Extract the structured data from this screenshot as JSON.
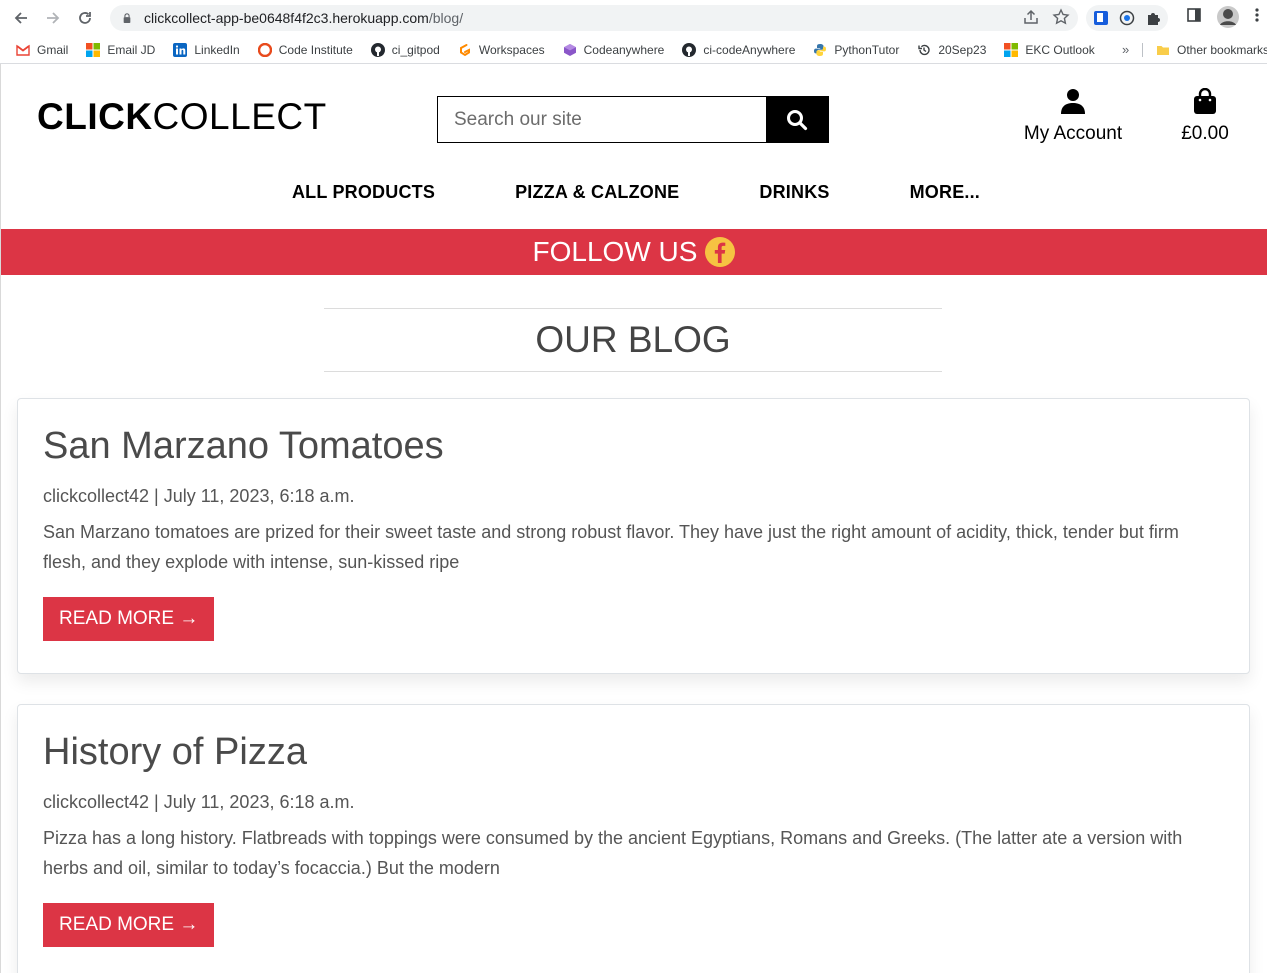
{
  "browser": {
    "url_host": "clickcollect-app-be0648f4f2c3.herokuapp.com",
    "url_path": "/blog/",
    "bookmarks": [
      {
        "label": "Gmail",
        "icon": "gmail-icon"
      },
      {
        "label": "Email JD",
        "icon": "microsoft-icon"
      },
      {
        "label": "LinkedIn",
        "icon": "linkedin-icon"
      },
      {
        "label": "Code Institute",
        "icon": "code-institute-icon"
      },
      {
        "label": "ci_gitpod",
        "icon": "github-icon"
      },
      {
        "label": "Workspaces",
        "icon": "gitpod-icon"
      },
      {
        "label": "Codeanywhere",
        "icon": "codeanywhere-icon"
      },
      {
        "label": "ci-codeAnywhere",
        "icon": "github-icon"
      },
      {
        "label": "PythonTutor",
        "icon": "python-icon"
      },
      {
        "label": "20Sep23",
        "icon": "history-icon"
      },
      {
        "label": "EKC Outlook",
        "icon": "microsoft-icon"
      }
    ],
    "more_bookmarks": "»",
    "other_bookmarks": "Other bookmarks"
  },
  "site": {
    "logo_bold": "CLICK",
    "logo_rest": "COLLECT",
    "search_placeholder": "Search our site",
    "account_label": "My Account",
    "cart_total": "£0.00",
    "nav": [
      "ALL PRODUCTS",
      "PIZZA & CALZONE",
      "DRINKS",
      "MORE..."
    ],
    "follow_text": "FOLLOW US",
    "brand_color": "#dc3545"
  },
  "blog": {
    "heading": "OUR BLOG",
    "posts": [
      {
        "title": "San Marzano Tomatoes",
        "meta": "clickcollect42 | July 11, 2023, 6:18 a.m.",
        "excerpt": "San Marzano tomatoes are prized for their sweet taste and strong robust flavor. They have just the right amount of acidity, thick, tender but firm flesh, and they explode with intense, sun-kissed ripe",
        "button": "READ MORE →"
      },
      {
        "title": "History of Pizza",
        "meta": "clickcollect42 | July 11, 2023, 6:18 a.m.",
        "excerpt": "Pizza has a long history. Flatbreads with toppings were consumed by the ancient Egyptians, Romans and Greeks. (The latter ate a version with herbs and oil, similar to today’s focaccia.) But the modern",
        "button": "READ MORE →"
      }
    ]
  }
}
